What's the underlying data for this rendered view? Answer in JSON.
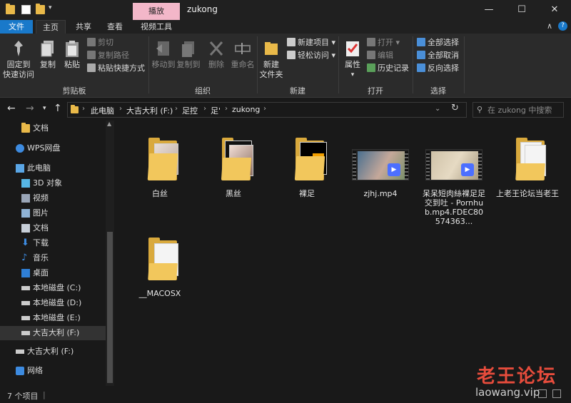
{
  "window": {
    "title": "zukong",
    "contextual_tab": "播放",
    "minimize_glyph": "—",
    "maximize_glyph": "☐",
    "close_glyph": "✕"
  },
  "ribbon_tabs": [
    "文件",
    "主页",
    "共享",
    "查看",
    "视频工具"
  ],
  "ribbon": {
    "clipboard": {
      "label": "剪贴板",
      "pin": "固定到\n快速访问",
      "copy": "复制",
      "paste": "粘贴",
      "cut": "剪切",
      "copy_path": "复制路径",
      "paste_shortcut": "粘贴快捷方式"
    },
    "organize": {
      "label": "组织",
      "move_to": "移动到",
      "copy_to": "复制到",
      "delete": "删除",
      "rename": "重命名"
    },
    "new": {
      "label": "新建",
      "new_folder": "新建\n文件夹",
      "new_item": "新建项目",
      "easy_access": "轻松访问"
    },
    "open": {
      "label": "打开",
      "properties": "属性",
      "open": "打开",
      "edit": "编辑",
      "history": "历史记录"
    },
    "select": {
      "label": "选择",
      "select_all": "全部选择",
      "select_none": "全部取消",
      "invert": "反向选择"
    }
  },
  "address": {
    "crumbs": [
      "此电脑",
      "大吉大利 (F:)",
      "足控",
      "足'",
      "zukong"
    ],
    "search_placeholder": "在 zukong 中搜索"
  },
  "nav_pane": {
    "items": [
      {
        "label": "文档",
        "icon": "pin-folder-icon"
      },
      {
        "label": "WPS网盘",
        "icon": "cloud-icon"
      },
      {
        "label": "此电脑",
        "icon": "computer-icon"
      },
      {
        "label": "3D 对象",
        "icon": "cube-icon"
      },
      {
        "label": "视频",
        "icon": "video-folder-icon"
      },
      {
        "label": "图片",
        "icon": "picture-folder-icon"
      },
      {
        "label": "文档",
        "icon": "document-folder-icon"
      },
      {
        "label": "下载",
        "icon": "download-arrow-icon"
      },
      {
        "label": "音乐",
        "icon": "music-note-icon"
      },
      {
        "label": "桌面",
        "icon": "desktop-icon"
      },
      {
        "label": "本地磁盘 (C:)",
        "icon": "drive-icon"
      },
      {
        "label": "本地磁盘 (D:)",
        "icon": "drive-icon"
      },
      {
        "label": "本地磁盘 (E:)",
        "icon": "drive-icon"
      },
      {
        "label": "大吉大利 (F:)",
        "icon": "drive-icon"
      },
      {
        "label": "大吉大利 (F:)",
        "icon": "drive-icon"
      },
      {
        "label": "网络",
        "icon": "network-icon"
      }
    ]
  },
  "files": [
    {
      "name": "白丝",
      "type": "folder"
    },
    {
      "name": "黑丝",
      "type": "folder"
    },
    {
      "name": "裸足",
      "type": "folder"
    },
    {
      "name": "zjhj.mp4",
      "type": "video"
    },
    {
      "name": "呆呆短肉絲裸足足交到吐 - Pornhub.mp4.FDEC80574363...",
      "type": "video"
    },
    {
      "name": "上老王论坛当老王",
      "type": "folder-docs"
    },
    {
      "name": "__MACOSX",
      "type": "folder-docs"
    }
  ],
  "status": {
    "count": "7 个项目"
  },
  "watermark": {
    "cn": "老王论坛",
    "en": "laowang.vip"
  },
  "colors": {
    "accent": "#1979ca",
    "context_tab": "#f3b7c9",
    "folder": "#f2c75c",
    "watermark": "#e74c3c"
  }
}
